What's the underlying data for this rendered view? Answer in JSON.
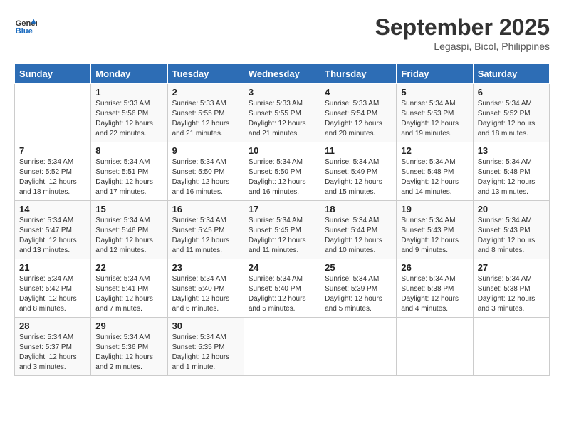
{
  "header": {
    "logo_line1": "General",
    "logo_line2": "Blue",
    "month": "September 2025",
    "location": "Legaspi, Bicol, Philippines"
  },
  "weekdays": [
    "Sunday",
    "Monday",
    "Tuesday",
    "Wednesday",
    "Thursday",
    "Friday",
    "Saturday"
  ],
  "weeks": [
    [
      {
        "day": "",
        "info": ""
      },
      {
        "day": "1",
        "info": "Sunrise: 5:33 AM\nSunset: 5:56 PM\nDaylight: 12 hours\nand 22 minutes."
      },
      {
        "day": "2",
        "info": "Sunrise: 5:33 AM\nSunset: 5:55 PM\nDaylight: 12 hours\nand 21 minutes."
      },
      {
        "day": "3",
        "info": "Sunrise: 5:33 AM\nSunset: 5:55 PM\nDaylight: 12 hours\nand 21 minutes."
      },
      {
        "day": "4",
        "info": "Sunrise: 5:33 AM\nSunset: 5:54 PM\nDaylight: 12 hours\nand 20 minutes."
      },
      {
        "day": "5",
        "info": "Sunrise: 5:34 AM\nSunset: 5:53 PM\nDaylight: 12 hours\nand 19 minutes."
      },
      {
        "day": "6",
        "info": "Sunrise: 5:34 AM\nSunset: 5:52 PM\nDaylight: 12 hours\nand 18 minutes."
      }
    ],
    [
      {
        "day": "7",
        "info": "Sunrise: 5:34 AM\nSunset: 5:52 PM\nDaylight: 12 hours\nand 18 minutes."
      },
      {
        "day": "8",
        "info": "Sunrise: 5:34 AM\nSunset: 5:51 PM\nDaylight: 12 hours\nand 17 minutes."
      },
      {
        "day": "9",
        "info": "Sunrise: 5:34 AM\nSunset: 5:50 PM\nDaylight: 12 hours\nand 16 minutes."
      },
      {
        "day": "10",
        "info": "Sunrise: 5:34 AM\nSunset: 5:50 PM\nDaylight: 12 hours\nand 16 minutes."
      },
      {
        "day": "11",
        "info": "Sunrise: 5:34 AM\nSunset: 5:49 PM\nDaylight: 12 hours\nand 15 minutes."
      },
      {
        "day": "12",
        "info": "Sunrise: 5:34 AM\nSunset: 5:48 PM\nDaylight: 12 hours\nand 14 minutes."
      },
      {
        "day": "13",
        "info": "Sunrise: 5:34 AM\nSunset: 5:48 PM\nDaylight: 12 hours\nand 13 minutes."
      }
    ],
    [
      {
        "day": "14",
        "info": "Sunrise: 5:34 AM\nSunset: 5:47 PM\nDaylight: 12 hours\nand 13 minutes."
      },
      {
        "day": "15",
        "info": "Sunrise: 5:34 AM\nSunset: 5:46 PM\nDaylight: 12 hours\nand 12 minutes."
      },
      {
        "day": "16",
        "info": "Sunrise: 5:34 AM\nSunset: 5:45 PM\nDaylight: 12 hours\nand 11 minutes."
      },
      {
        "day": "17",
        "info": "Sunrise: 5:34 AM\nSunset: 5:45 PM\nDaylight: 12 hours\nand 11 minutes."
      },
      {
        "day": "18",
        "info": "Sunrise: 5:34 AM\nSunset: 5:44 PM\nDaylight: 12 hours\nand 10 minutes."
      },
      {
        "day": "19",
        "info": "Sunrise: 5:34 AM\nSunset: 5:43 PM\nDaylight: 12 hours\nand 9 minutes."
      },
      {
        "day": "20",
        "info": "Sunrise: 5:34 AM\nSunset: 5:43 PM\nDaylight: 12 hours\nand 8 minutes."
      }
    ],
    [
      {
        "day": "21",
        "info": "Sunrise: 5:34 AM\nSunset: 5:42 PM\nDaylight: 12 hours\nand 8 minutes."
      },
      {
        "day": "22",
        "info": "Sunrise: 5:34 AM\nSunset: 5:41 PM\nDaylight: 12 hours\nand 7 minutes."
      },
      {
        "day": "23",
        "info": "Sunrise: 5:34 AM\nSunset: 5:40 PM\nDaylight: 12 hours\nand 6 minutes."
      },
      {
        "day": "24",
        "info": "Sunrise: 5:34 AM\nSunset: 5:40 PM\nDaylight: 12 hours\nand 5 minutes."
      },
      {
        "day": "25",
        "info": "Sunrise: 5:34 AM\nSunset: 5:39 PM\nDaylight: 12 hours\nand 5 minutes."
      },
      {
        "day": "26",
        "info": "Sunrise: 5:34 AM\nSunset: 5:38 PM\nDaylight: 12 hours\nand 4 minutes."
      },
      {
        "day": "27",
        "info": "Sunrise: 5:34 AM\nSunset: 5:38 PM\nDaylight: 12 hours\nand 3 minutes."
      }
    ],
    [
      {
        "day": "28",
        "info": "Sunrise: 5:34 AM\nSunset: 5:37 PM\nDaylight: 12 hours\nand 3 minutes."
      },
      {
        "day": "29",
        "info": "Sunrise: 5:34 AM\nSunset: 5:36 PM\nDaylight: 12 hours\nand 2 minutes."
      },
      {
        "day": "30",
        "info": "Sunrise: 5:34 AM\nSunset: 5:35 PM\nDaylight: 12 hours\nand 1 minute."
      },
      {
        "day": "",
        "info": ""
      },
      {
        "day": "",
        "info": ""
      },
      {
        "day": "",
        "info": ""
      },
      {
        "day": "",
        "info": ""
      }
    ]
  ]
}
